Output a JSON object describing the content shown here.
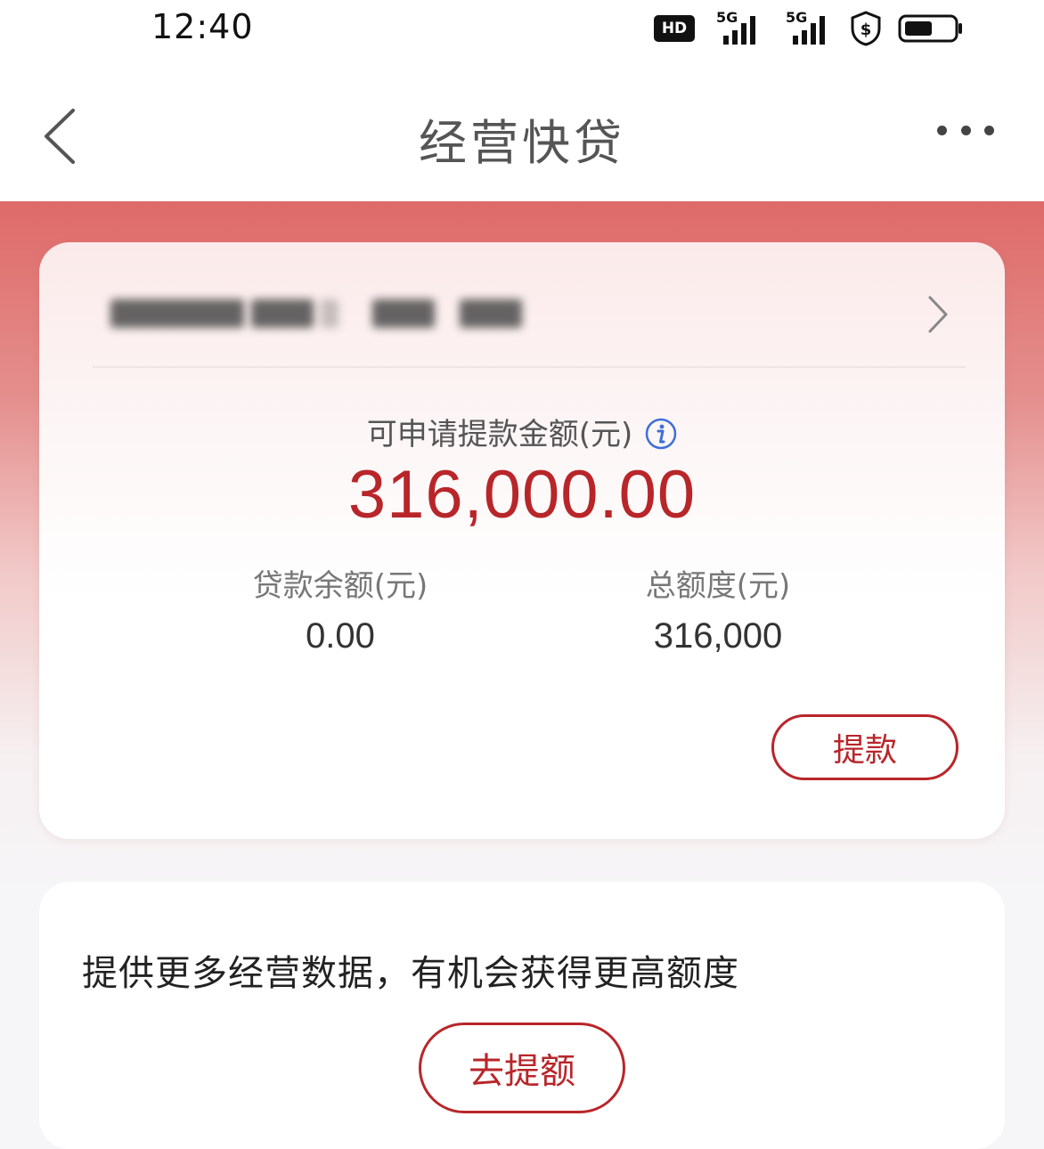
{
  "status_bar": {
    "time": "12:40",
    "hd_label": "HD",
    "network_1": "5G",
    "network_2": "5G",
    "icons": [
      "hd-voice-icon",
      "signal-5g-icon",
      "signal-5g-icon",
      "security-shield-icon",
      "battery-icon"
    ]
  },
  "nav": {
    "title": "经营快贷",
    "back_icon": "chevron-left-icon",
    "more_icon": "more-dots-icon"
  },
  "loan_card": {
    "available_label": "可申请提款金额(元)",
    "available_amount": "316,000.00",
    "balance_label": "贷款余额(元)",
    "balance_value": "0.00",
    "total_label": "总额度(元)",
    "total_value": "316,000",
    "withdraw_label": "提款"
  },
  "promo": {
    "text": "提供更多经营数据，有机会获得更高额度",
    "button_label": "去提额"
  },
  "colors": {
    "accent": "#b8262a",
    "hero_top": "#de6a68",
    "page_bg": "#f6f6f8"
  }
}
